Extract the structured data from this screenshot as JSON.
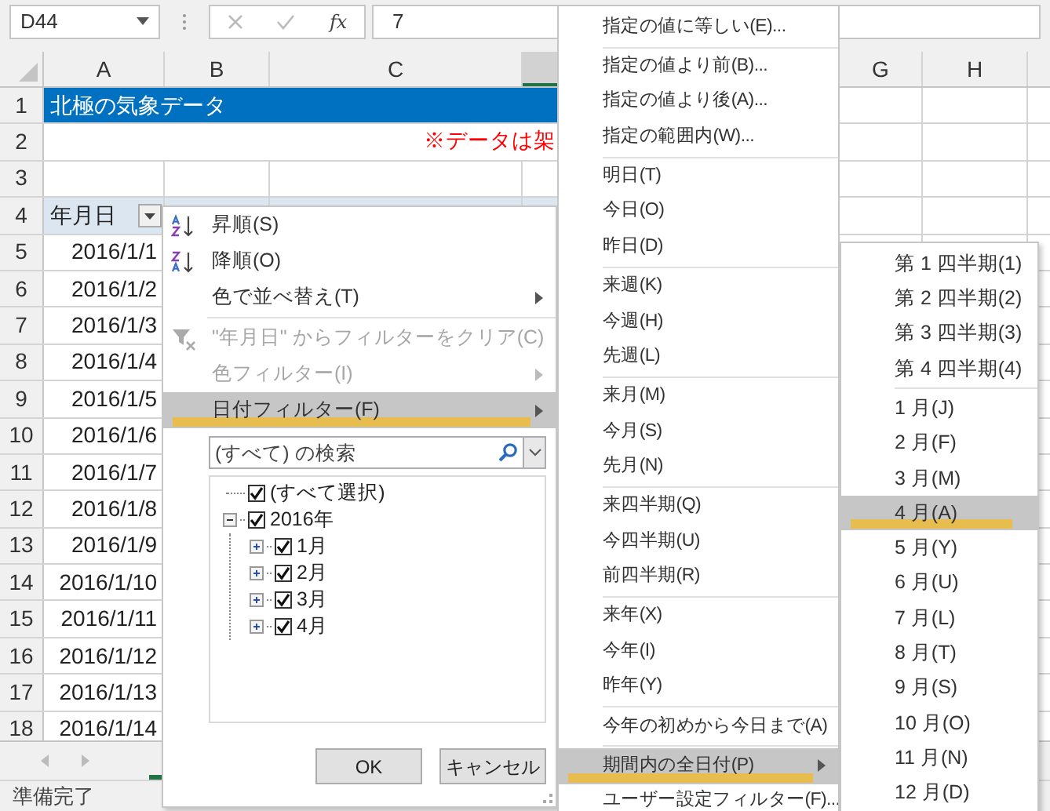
{
  "formula_bar": {
    "name_box": "D44",
    "function_label": "fx",
    "formula": "7"
  },
  "columns": [
    {
      "label": "A",
      "selected": false
    },
    {
      "label": "B",
      "selected": false
    },
    {
      "label": "C",
      "selected": false
    },
    {
      "selected": true
    },
    {
      "label": "G",
      "selected": false
    },
    {
      "label": "H",
      "selected": false
    }
  ],
  "rows": [
    {
      "number": "1",
      "kind": "title",
      "text": "北極の気象データ"
    },
    {
      "number": "2",
      "kind": "note",
      "text": "※データは架"
    },
    {
      "number": "3",
      "kind": "blank"
    },
    {
      "number": "4",
      "kind": "header",
      "text": "年月日"
    },
    {
      "number": "5",
      "kind": "date",
      "text": "2016/1/1"
    },
    {
      "number": "6",
      "kind": "date",
      "text": "2016/1/2"
    },
    {
      "number": "7",
      "kind": "date",
      "text": "2016/1/3"
    },
    {
      "number": "8",
      "kind": "date",
      "text": "2016/1/4"
    },
    {
      "number": "9",
      "kind": "date",
      "text": "2016/1/5"
    },
    {
      "number": "10",
      "kind": "date",
      "text": "2016/1/6"
    },
    {
      "number": "11",
      "kind": "date",
      "text": "2016/1/7"
    },
    {
      "number": "12",
      "kind": "date",
      "text": "2016/1/8"
    },
    {
      "number": "13",
      "kind": "date",
      "text": "2016/1/9"
    },
    {
      "number": "14",
      "kind": "date",
      "text": "2016/1/10"
    },
    {
      "number": "15",
      "kind": "date",
      "text": "2016/1/11"
    },
    {
      "number": "16",
      "kind": "date",
      "text": "2016/1/12"
    },
    {
      "number": "17",
      "kind": "date",
      "text": "2016/1/13"
    },
    {
      "number": "18",
      "kind": "date",
      "text": "2016/1/14"
    }
  ],
  "filter_menu": {
    "items": [
      {
        "kind": "sort_asc",
        "label": "昇順(S)",
        "disabled": false,
        "submenu": false,
        "selected": false
      },
      {
        "kind": "sort_desc",
        "label": "降順(O)",
        "disabled": false,
        "submenu": false,
        "selected": false
      },
      {
        "kind": "item",
        "label": "色で並べ替え(T)",
        "disabled": false,
        "submenu": true,
        "selected": false
      },
      {
        "kind": "separator"
      },
      {
        "kind": "clear_filter",
        "label": "\"年月日\" からフィルターをクリア(C)",
        "disabled": true,
        "submenu": false,
        "selected": false
      },
      {
        "kind": "item",
        "label": "色フィルター(I)",
        "disabled": true,
        "submenu": true,
        "selected": false
      },
      {
        "kind": "item",
        "label": "日付フィルター(F)",
        "disabled": false,
        "submenu": true,
        "selected": true
      }
    ],
    "search": {
      "placeholder": "(すべて) の検索"
    },
    "tree": [
      {
        "label": "(すべて選択)",
        "checked": true
      },
      {
        "label": "2016年",
        "checked": true,
        "expanded": true,
        "children": [
          {
            "label": "1月",
            "checked": true,
            "expanded": false
          },
          {
            "label": "2月",
            "checked": true,
            "expanded": false
          },
          {
            "label": "3月",
            "checked": true,
            "expanded": false
          },
          {
            "label": "4月",
            "checked": true,
            "expanded": false
          }
        ]
      }
    ],
    "buttons": [
      "OK",
      "キャンセル"
    ]
  },
  "date_filter_menu": {
    "items": [
      {
        "kind": "item",
        "label": "指定の値に等しい(E)...",
        "submenu": false,
        "selected": false
      },
      {
        "kind": "separator"
      },
      {
        "kind": "item",
        "label": "指定の値より前(B)...",
        "submenu": false,
        "selected": false
      },
      {
        "kind": "item",
        "label": "指定の値より後(A)...",
        "submenu": false,
        "selected": false
      },
      {
        "kind": "item",
        "label": "指定の範囲内(W)...",
        "submenu": false,
        "selected": false
      },
      {
        "kind": "separator"
      },
      {
        "kind": "item",
        "label": "明日(T)",
        "submenu": false,
        "selected": false
      },
      {
        "kind": "item",
        "label": "今日(O)",
        "submenu": false,
        "selected": false
      },
      {
        "kind": "item",
        "label": "昨日(D)",
        "submenu": false,
        "selected": false
      },
      {
        "kind": "separator"
      },
      {
        "kind": "item",
        "label": "来週(K)",
        "submenu": false,
        "selected": false
      },
      {
        "kind": "item",
        "label": "今週(H)",
        "submenu": false,
        "selected": false
      },
      {
        "kind": "item",
        "label": "先週(L)",
        "submenu": false,
        "selected": false
      },
      {
        "kind": "separator"
      },
      {
        "kind": "item",
        "label": "来月(M)",
        "submenu": false,
        "selected": false
      },
      {
        "kind": "item",
        "label": "今月(S)",
        "submenu": false,
        "selected": false
      },
      {
        "kind": "item",
        "label": "先月(N)",
        "submenu": false,
        "selected": false
      },
      {
        "kind": "separator"
      },
      {
        "kind": "item",
        "label": "来四半期(Q)",
        "submenu": false,
        "selected": false
      },
      {
        "kind": "item",
        "label": "今四半期(U)",
        "submenu": false,
        "selected": false
      },
      {
        "kind": "item",
        "label": "前四半期(R)",
        "submenu": false,
        "selected": false
      },
      {
        "kind": "separator"
      },
      {
        "kind": "item",
        "label": "来年(X)",
        "submenu": false,
        "selected": false
      },
      {
        "kind": "item",
        "label": "今年(I)",
        "submenu": false,
        "selected": false
      },
      {
        "kind": "item",
        "label": "昨年(Y)",
        "submenu": false,
        "selected": false
      },
      {
        "kind": "separator"
      },
      {
        "kind": "item",
        "label": "今年の初めから今日まで(A)",
        "submenu": false,
        "selected": false
      },
      {
        "kind": "separator"
      },
      {
        "kind": "item",
        "label": "期間内の全日付(P)",
        "submenu": true,
        "selected": true
      },
      {
        "kind": "item",
        "label": "ユーザー設定フィルター(F)...",
        "submenu": false,
        "selected": false
      }
    ]
  },
  "period_menu": {
    "items": [
      {
        "kind": "item",
        "label": "第 1 四半期(1)",
        "selected": false
      },
      {
        "kind": "item",
        "label": "第 2 四半期(2)",
        "selected": false
      },
      {
        "kind": "item",
        "label": "第 3 四半期(3)",
        "selected": false
      },
      {
        "kind": "item",
        "label": "第 4 四半期(4)",
        "selected": false
      },
      {
        "kind": "separator"
      },
      {
        "kind": "item",
        "label": "1 月(J)",
        "selected": false
      },
      {
        "kind": "item",
        "label": "2 月(F)",
        "selected": false
      },
      {
        "kind": "item",
        "label": "3 月(M)",
        "selected": false
      },
      {
        "kind": "item",
        "label": "4 月(A)",
        "selected": true
      },
      {
        "kind": "item",
        "label": "5 月(Y)",
        "selected": false
      },
      {
        "kind": "item",
        "label": "6 月(U)",
        "selected": false
      },
      {
        "kind": "item",
        "label": "7 月(L)",
        "selected": false
      },
      {
        "kind": "item",
        "label": "8 月(T)",
        "selected": false
      },
      {
        "kind": "item",
        "label": "9 月(S)",
        "selected": false
      },
      {
        "kind": "item",
        "label": "10 月(O)",
        "selected": false
      },
      {
        "kind": "item",
        "label": "11 月(N)",
        "selected": false
      },
      {
        "kind": "item",
        "label": "12 月(D)",
        "selected": false
      }
    ]
  },
  "status_bar": {
    "text": "準備完了"
  }
}
